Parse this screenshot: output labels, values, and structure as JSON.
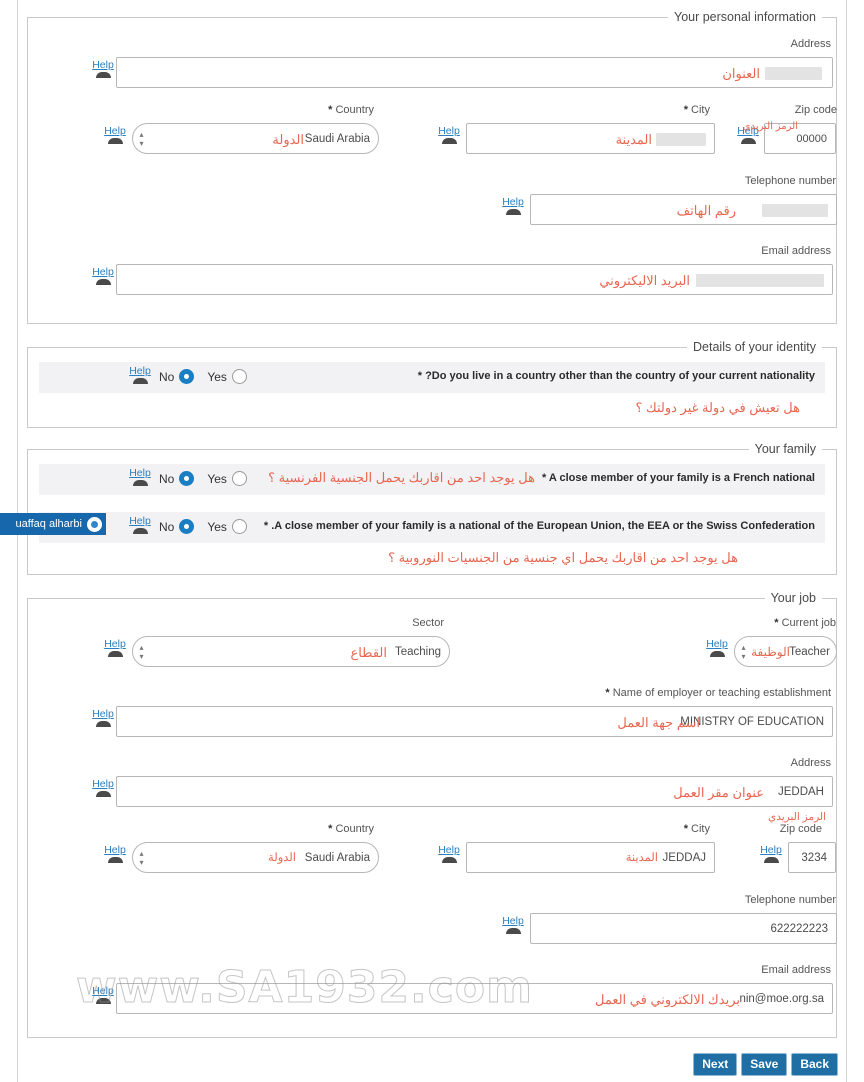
{
  "sections": {
    "personal": {
      "legend": "Your personal information",
      "address": {
        "label": "Address",
        "arabic": "العنوان",
        "value": "",
        "redacted": true
      },
      "country": {
        "label": "Country",
        "required": "*",
        "arabic": "الدولة",
        "value": "Saudi Arabia"
      },
      "city": {
        "label": "City",
        "required": "*",
        "arabic": "المدينة",
        "value": "",
        "redacted": true
      },
      "zip": {
        "label": "Zip code",
        "arabic": "الرمز البريدي",
        "value": "00000"
      },
      "telephone": {
        "label": "Telephone number",
        "arabic": "رقم الهاتف",
        "value": "",
        "redacted": true
      },
      "email": {
        "label": "Email address",
        "arabic": "البريد الاليكتروني",
        "value": "",
        "redacted": true
      }
    },
    "identity": {
      "legend": "Details of your identity",
      "question": {
        "text": "* ?Do you live in a country other than the country of your current nationality",
        "arabic": "هل تعيش في دولة غير دولتك ؟",
        "no_label": "No",
        "yes_label": "Yes",
        "selected": "No"
      }
    },
    "family": {
      "legend": "Your family",
      "questions": [
        {
          "text": "* A close member of your family is a French national",
          "arabic_inline": "هل يوجد احد من اقاربك يحمل الجنسية الفرنسية ؟",
          "arabic_below": "",
          "no_label": "No",
          "yes_label": "Yes",
          "selected": "No"
        },
        {
          "text": "* .A close member of your family is a national of the European Union, the EEA or the Swiss Confederation",
          "arabic_inline": "",
          "arabic_below": "هل يوجد احد من اقاربك يحمل اي جنسية من الجنسيات النوروبية ؟",
          "no_label": "No",
          "yes_label": "Yes",
          "selected": "No"
        }
      ]
    },
    "job": {
      "legend": "Your job",
      "sector": {
        "label": "Sector",
        "arabic": "القطاع",
        "value": "Teaching"
      },
      "current_job": {
        "label": "Current job",
        "required": "*",
        "arabic": "الوظيفة",
        "value": "Teacher"
      },
      "employer": {
        "label": "Name of employer or teaching establishment",
        "required": "*",
        "arabic": "اسم جهة العمل",
        "value": "MINISTRY OF EDUCATION"
      },
      "work_address": {
        "label": "Address",
        "arabic": "عنوان مقر العمل",
        "value": "JEDDAH"
      },
      "work_country": {
        "label": "Country",
        "required": "*",
        "arabic": "الدولة",
        "value": "Saudi Arabia"
      },
      "work_city": {
        "label": "City",
        "required": "*",
        "arabic": "المدينة",
        "value": "JEDDAJ"
      },
      "work_zip": {
        "label": "Zip code",
        "arabic": "الرمز البريدي",
        "value": "3234"
      },
      "work_telephone": {
        "label": "Telephone number",
        "arabic": "",
        "value": "622222223"
      },
      "work_email": {
        "label": "Email address",
        "arabic": "بريدك الالكتروني في العمل",
        "value": "nin@moe.org.sa"
      }
    }
  },
  "help_label": "Help",
  "user_tab": {
    "name": "uaffaq alharbi"
  },
  "buttons": {
    "next": "Next",
    "save": "Save",
    "back": "Back"
  },
  "watermark": "www.SA1932.com",
  "colors": {
    "accent_blue": "#1a7ec4",
    "arabic_red": "#e8654f",
    "button_blue": "#1f6fa5",
    "tab_blue": "#1667ab"
  }
}
